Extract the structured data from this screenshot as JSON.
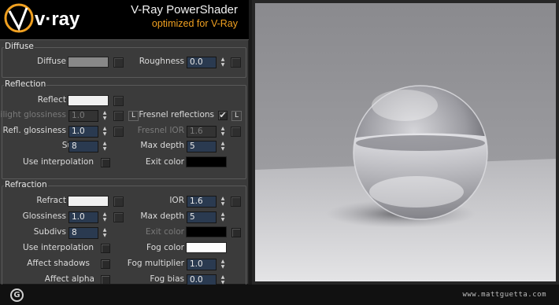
{
  "header": {
    "logo_text": "V·ray",
    "title": "V-Ray PowerShader",
    "subtitle": "optimized for V-Ray"
  },
  "diffuse": {
    "section_title": "Diffuse",
    "diffuse_label": "Diffuse",
    "diffuse_color": "#888888",
    "roughness_label": "Roughness",
    "roughness_value": "0.0"
  },
  "reflection": {
    "section_title": "Reflection",
    "reflect_label": "Reflect",
    "reflect_color": "#f0f0f0",
    "hilight_label": "Hilight glossiness",
    "hilight_value": "1.0",
    "lock_label": "L",
    "fresnel_label": "Fresnel reflections",
    "fresnel_checked": "✔",
    "fresnel_lock_label": "L",
    "refl_gloss_label": "Refl. glossiness",
    "refl_gloss_value": "1.0",
    "fresnel_ior_label": "Fresnel IOR",
    "fresnel_ior_value": "1.6",
    "subdivs_label": "Subdivs",
    "subdivs_value": "8",
    "max_depth_label": "Max depth",
    "max_depth_value": "5",
    "use_interp_label": "Use interpolation",
    "exit_color_label": "Exit color",
    "exit_color": "#000000"
  },
  "refraction": {
    "section_title": "Refraction",
    "refract_label": "Refract",
    "refract_color": "#f0f0f0",
    "ior_label": "IOR",
    "ior_value": "1.6",
    "glossiness_label": "Glossiness",
    "glossiness_value": "1.0",
    "max_depth_label": "Max depth",
    "max_depth_value": "5",
    "subdivs_label": "Subdivs",
    "subdivs_value": "8",
    "exit_color_label": "Exit color",
    "exit_color": "#000000",
    "use_interp_label": "Use interpolation",
    "fog_color_label": "Fog color",
    "fog_color": "#ffffff",
    "affect_shadows_label": "Affect shadows",
    "fog_mult_label": "Fog multiplier",
    "fog_mult_value": "1.0",
    "affect_alpha_label": "Affect alpha",
    "fog_bias_label": "Fog bias",
    "fog_bias_value": "0.0"
  },
  "footer": {
    "copyright_symbol": "G",
    "site": "www.mattguetta.com"
  },
  "colors": {
    "accent_orange": "#f0a020",
    "panel_bg": "#3b3b3b",
    "spinner_bg": "#2a3a50"
  },
  "icons": [
    "vray-logo-icon",
    "map-slot-button",
    "spinner-arrows-icon",
    "checkbox",
    "copyright-icon",
    "glass-sphere-preview"
  ]
}
